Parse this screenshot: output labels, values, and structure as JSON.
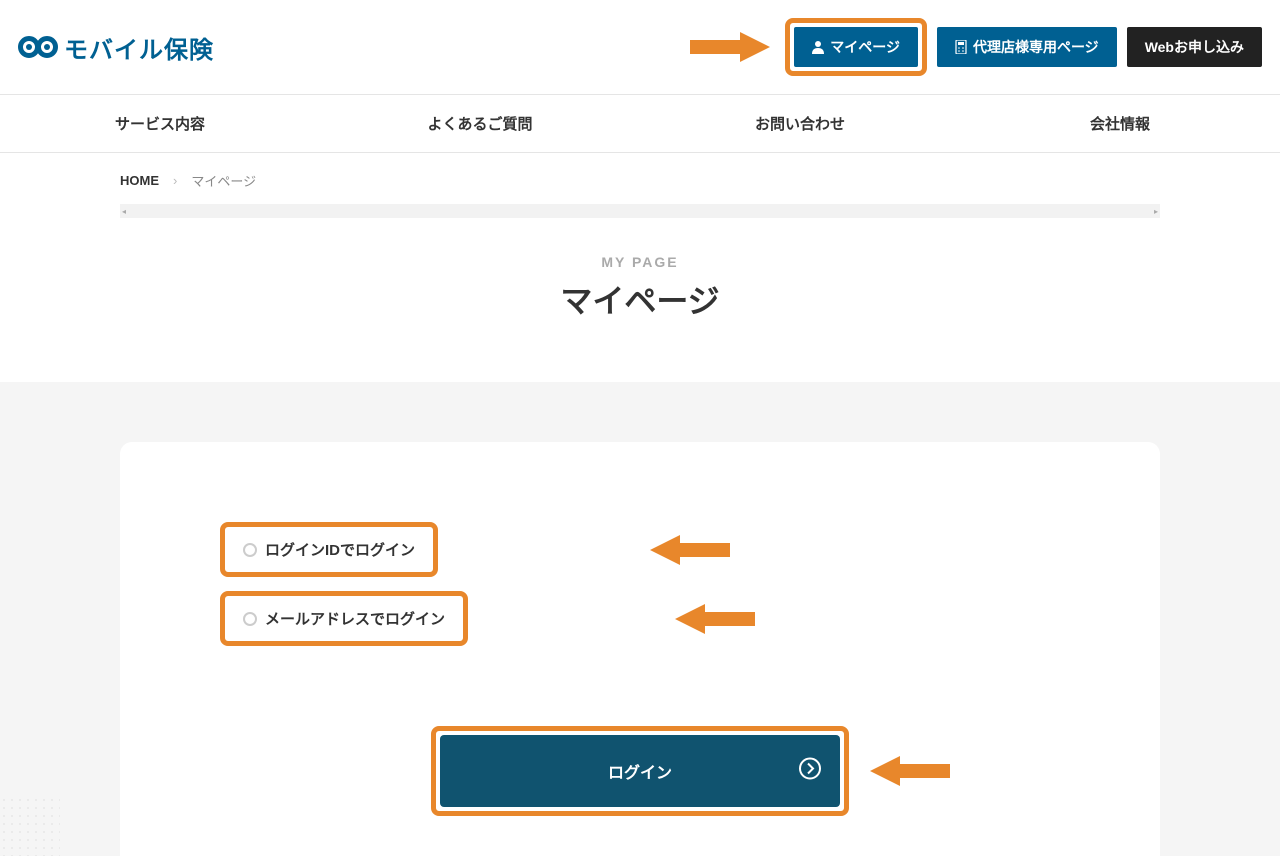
{
  "logo": {
    "text": "モバイル保険"
  },
  "header_buttons": {
    "mypage": "マイページ",
    "agent_page": "代理店様専用ページ",
    "web_apply": "Webお申し込み"
  },
  "nav": {
    "items": [
      "サービス内容",
      "よくあるご質問",
      "お問い合わせ",
      "会社情報"
    ]
  },
  "breadcrumb": {
    "home": "HOME",
    "current": "マイページ"
  },
  "page_title": {
    "en": "MY PAGE",
    "jp": "マイページ"
  },
  "login": {
    "option_id": "ログインIDでログイン",
    "option_email": "メールアドレスでログイン",
    "button": "ログイン"
  },
  "colors": {
    "brand": "#006092",
    "highlight": "#e8872b",
    "dark": "#222222"
  }
}
